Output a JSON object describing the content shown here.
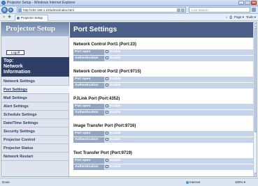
{
  "window": {
    "title": "Projector Setup - Windows Internet Explorer",
    "controls": [
      "_",
      "□",
      "×"
    ]
  },
  "address_bar": {
    "url": "http://192.168.1.10/admin/index.html",
    "search_placeholder": "Live Search"
  },
  "tabs": {
    "active_label": "Projector Setup",
    "commands": [
      "Page ▾",
      "Tools ▾"
    ]
  },
  "sidebar": {
    "logo": "Projector Setup",
    "logoff_label": "Logoff",
    "section": {
      "top": "Top:",
      "line1": "Network",
      "line2": "Information"
    },
    "items": [
      {
        "label": "Network Settings",
        "active": false
      },
      {
        "label": "Port Settings",
        "active": true
      },
      {
        "label": "Mail Settings",
        "active": false
      },
      {
        "label": "Alert Settings",
        "active": false
      },
      {
        "label": "Schedule Settings",
        "active": false
      },
      {
        "label": "Date/Time Settings",
        "active": false
      },
      {
        "label": "Security Settings",
        "active": false
      },
      {
        "label": "Projector Control",
        "active": false
      },
      {
        "label": "Projector Status",
        "active": false
      },
      {
        "label": "Network Restart",
        "active": false
      }
    ]
  },
  "content": {
    "heading": "Port Settings",
    "ports": [
      {
        "title": "Network Control Port1 (Port:23)",
        "rows": [
          {
            "key": "Port open",
            "value": "Enable"
          },
          {
            "key": "Authentication",
            "value": "Enable"
          }
        ]
      },
      {
        "title": "Network Control Port2 (Port:9715)",
        "rows": [
          {
            "key": "Port open",
            "value": "Enable"
          },
          {
            "key": "Authentication",
            "value": "Enable"
          }
        ]
      },
      {
        "title": "PJLink Port (Port:4352)",
        "rows": [
          {
            "key": "Port open",
            "value": "Enable"
          },
          {
            "key": "Authentication",
            "value": "Enable"
          }
        ]
      },
      {
        "title": "Image Transfer Port (Port:9716)",
        "rows": [
          {
            "key": "Port open",
            "value": "Enable"
          },
          {
            "key": "Authentication",
            "value": "Enable"
          }
        ]
      },
      {
        "title": "Text Transfer Port (Port:9719)",
        "rows": [
          {
            "key": "Port open",
            "value": "Enable"
          },
          {
            "key": "Authentication",
            "value": "Enable"
          }
        ]
      }
    ]
  },
  "status_bar": {
    "left": "Done",
    "zone": "Internet",
    "zoom": "100% ▾"
  },
  "colors": {
    "sidebar_header": "#2e3f66",
    "content_header": "#4c5f88",
    "row_key": "#92a6c6",
    "row_value": "#c5d4ea"
  }
}
